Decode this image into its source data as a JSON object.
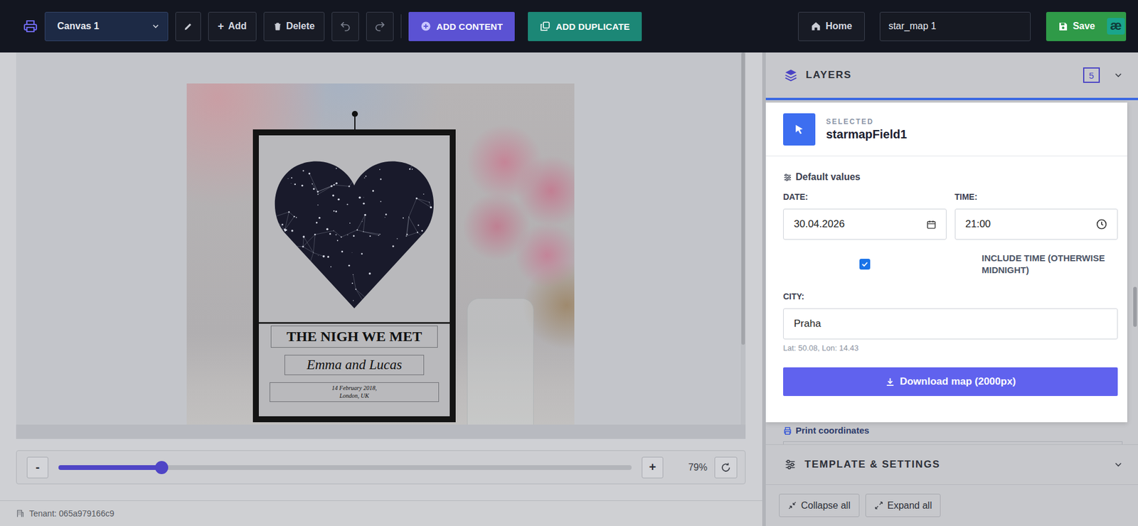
{
  "toolbar": {
    "canvas_select": {
      "label": "Canvas 1"
    },
    "add_button": {
      "icon": "+",
      "label": "Add"
    },
    "delete_button": {
      "label": "Delete"
    },
    "add_content_button": {
      "label": "ADD CONTENT"
    },
    "add_duplicate_button": {
      "label": "ADD DUPLICATE"
    },
    "home_button": {
      "label": "Home"
    },
    "project_name": {
      "value": "star_map 1"
    },
    "save_button": {
      "label": "Save"
    },
    "assistant_badge": {
      "label": "æ"
    }
  },
  "canvas": {
    "layers": [
      {
        "kind": "title",
        "text": "THE NIGH WE MET"
      },
      {
        "kind": "script",
        "text": "Emma and Lucas"
      },
      {
        "kind": "caption",
        "text": "14 February 2018,\nLondon, UK"
      }
    ]
  },
  "zoom": {
    "minus": "-",
    "plus": "+",
    "level": 0.18,
    "reading": "79%"
  },
  "status_bar": {
    "tenant": "Tenant: 065a979166c9"
  },
  "panel": {
    "layers_section": {
      "title": "LAYERS",
      "count": "5"
    },
    "selected": {
      "label": "SELECTED",
      "name": "starmapField1"
    },
    "default_values": {
      "title": "Default values",
      "date_label": "DATE:",
      "date": "30.04.2026",
      "time_label": "TIME:",
      "time": "21:00",
      "include_time": {
        "label": "INCLUDE TIME (OTHERWISE MIDNIGHT)",
        "checked": true
      },
      "city_label": "CITY:",
      "city": "Praha",
      "coords": "Lat: 50.08, Lon: 14.43",
      "download": "Download map (2000px)"
    },
    "print_coordinates": {
      "title": "Print coordinates"
    },
    "template_section": {
      "title": "TEMPLATE & SETTINGS"
    },
    "footer_buttons": [
      {
        "kind": "collapse",
        "label": "Collapse all"
      },
      {
        "kind": "expand",
        "label": "Expand all"
      }
    ]
  }
}
